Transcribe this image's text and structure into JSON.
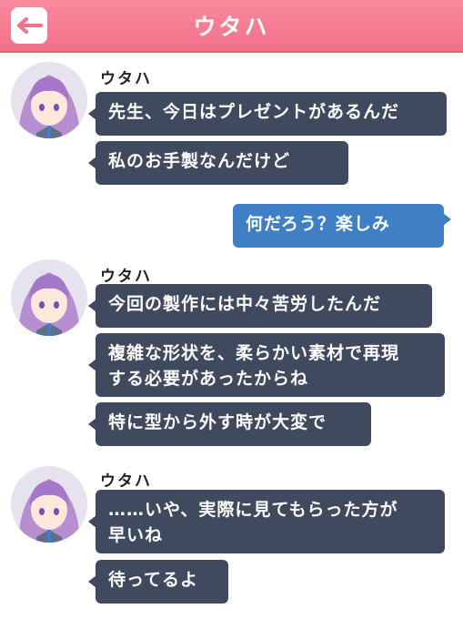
{
  "header": {
    "title": "ウタハ",
    "back_icon": "back-arrow-icon"
  },
  "colors": {
    "header": "#f2708a",
    "bubble_in": "#3f4a5f",
    "bubble_out": "#3f7fc5"
  },
  "messages": [
    {
      "sender": "ウタハ",
      "avatar": "utaha-avatar",
      "bubbles": [
        "先生、今日はプレゼントがあるんだ",
        "私のお手製なんだけど"
      ]
    },
    {
      "sender": "me",
      "bubbles": [
        "何だろう？楽しみ"
      ]
    },
    {
      "sender": "ウタハ",
      "avatar": "utaha-avatar",
      "bubbles": [
        "今回の製作には中々苦労したんだ",
        "複雑な形状を、柔らかい素材で再現\nする必要があったからね",
        "特に型から外す時が大変で"
      ]
    },
    {
      "sender": "ウタハ",
      "avatar": "utaha-avatar",
      "bubbles": [
        "……いや、実際に見てもらった方が\n早いね",
        "待ってるよ"
      ]
    }
  ]
}
